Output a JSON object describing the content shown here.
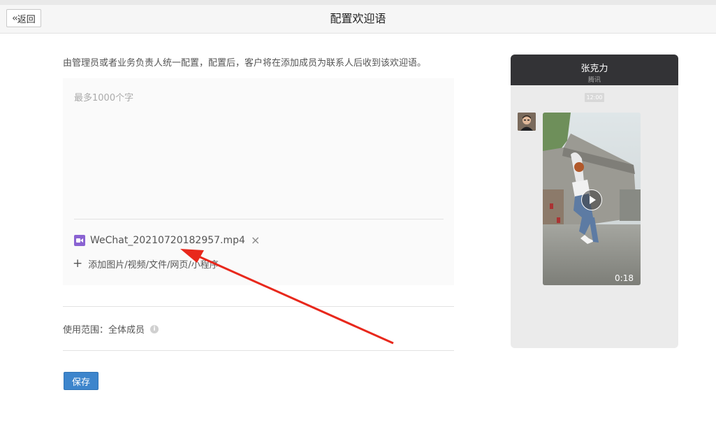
{
  "header": {
    "back_label": "返回",
    "title": "配置欢迎语"
  },
  "description": "由管理员或者业务负责人统一配置，配置后，客户将在添加成员为联系人后收到该欢迎语。",
  "editor": {
    "placeholder": "最多1000个字",
    "attachment": {
      "icon": "video-file-icon",
      "filename": "WeChat_20210720182957.mp4"
    },
    "add_label": "添加图片/视频/文件/网页/小程序"
  },
  "scope": {
    "label": "使用范围：",
    "value": "全体成员"
  },
  "save_label": "保存",
  "preview": {
    "contact_name": "张克力",
    "company": "腾讯",
    "time": "12:00",
    "video_duration": "0:18"
  },
  "colors": {
    "accent": "#3d85cc",
    "annotation_arrow": "#e8281c",
    "phone_header": "#333336"
  }
}
